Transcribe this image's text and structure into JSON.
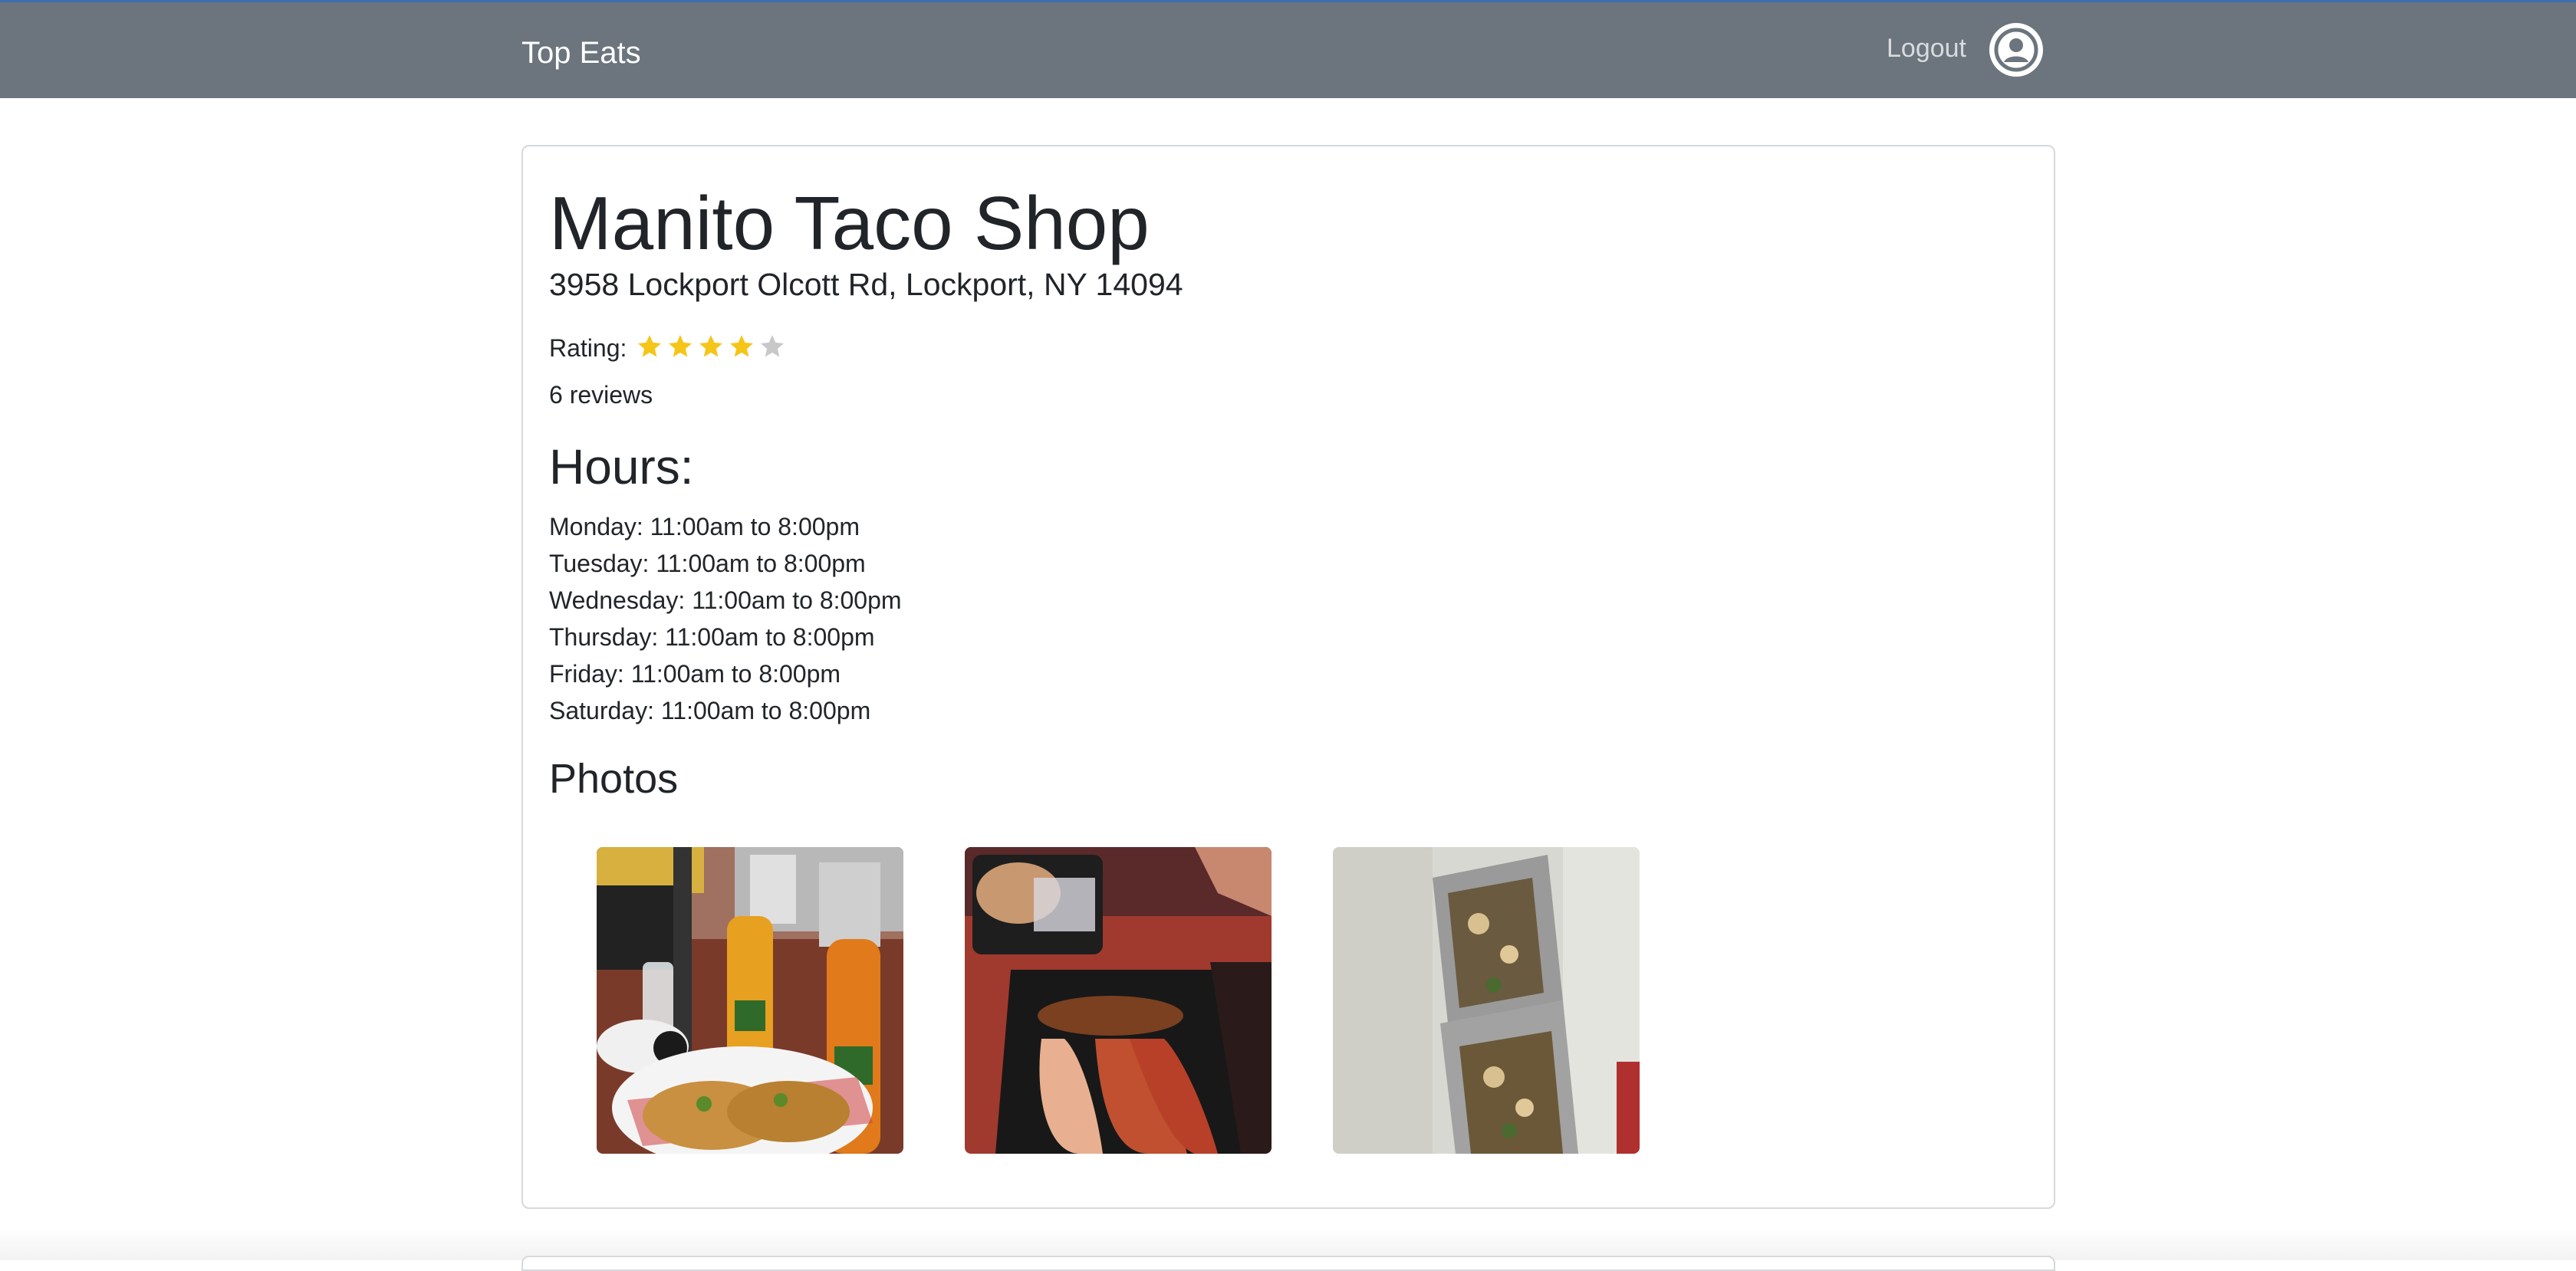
{
  "navbar": {
    "brand": "Top Eats",
    "logout_label": "Logout",
    "avatar_icon": "user-circle-icon"
  },
  "restaurant": {
    "name": "Manito Taco Shop",
    "address": "3958 Lockport Olcott Rd, Lockport, NY 14094",
    "rating_label": "Rating:",
    "rating_value": 4,
    "rating_max": 5,
    "reviews": "6 reviews"
  },
  "hours": {
    "heading": "Hours:",
    "days": [
      "Monday: 11:00am to 8:00pm",
      "Tuesday: 11:00am to 8:00pm",
      "Wednesday: 11:00am to 8:00pm",
      "Thursday: 11:00am to 8:00pm",
      "Friday: 11:00am to 8:00pm",
      "Saturday: 11:00am to 8:00pm"
    ]
  },
  "photos": {
    "heading": "Photos",
    "items": [
      "photo-tacos-and-drinks",
      "photo-takeout-tacos",
      "photo-foil-wrapped-tacos"
    ]
  },
  "colors": {
    "navbar": "#6c757d",
    "star_filled": "#f5c518",
    "star_empty": "#c8c8c8"
  }
}
